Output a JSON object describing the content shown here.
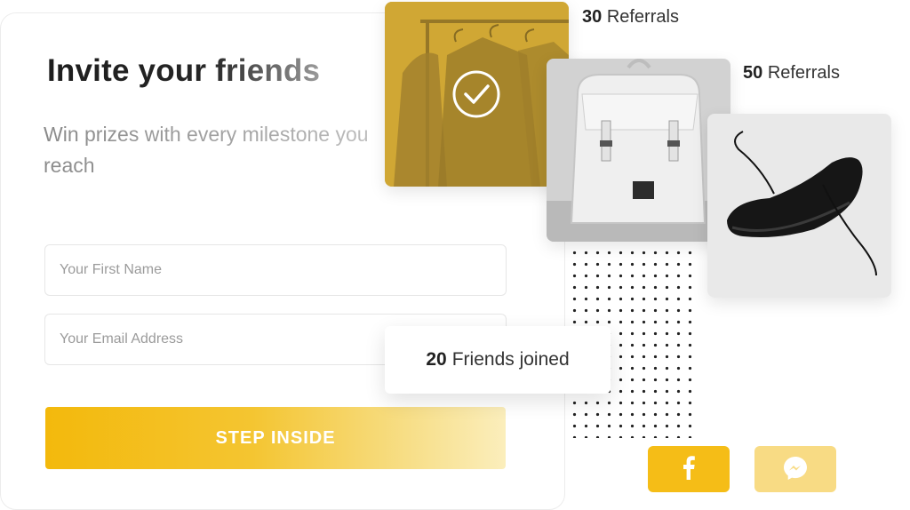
{
  "form": {
    "title": "Invite your friends",
    "subtitle": "Win prizes with every milestone you reach",
    "first_name_placeholder": "Your First Name",
    "email_placeholder": "Your Email Address",
    "submit_label": "STEP INSIDE"
  },
  "milestones": [
    {
      "count": "30",
      "label": "Referrals",
      "prize": "clothing rack",
      "unlocked": true
    },
    {
      "count": "50",
      "label": "Referrals",
      "prize": "backpack",
      "unlocked": false
    },
    {
      "prize": "sneaker",
      "unlocked": false
    }
  ],
  "joined": {
    "count": "20",
    "label": "Friends joined"
  },
  "social": [
    {
      "name": "facebook-icon",
      "glyph": "f"
    },
    {
      "name": "messenger-icon"
    }
  ],
  "colors": {
    "accent": "#f3b90c",
    "accent_light": "#f8db84",
    "text": "#222222",
    "muted": "#9b9b9b"
  }
}
